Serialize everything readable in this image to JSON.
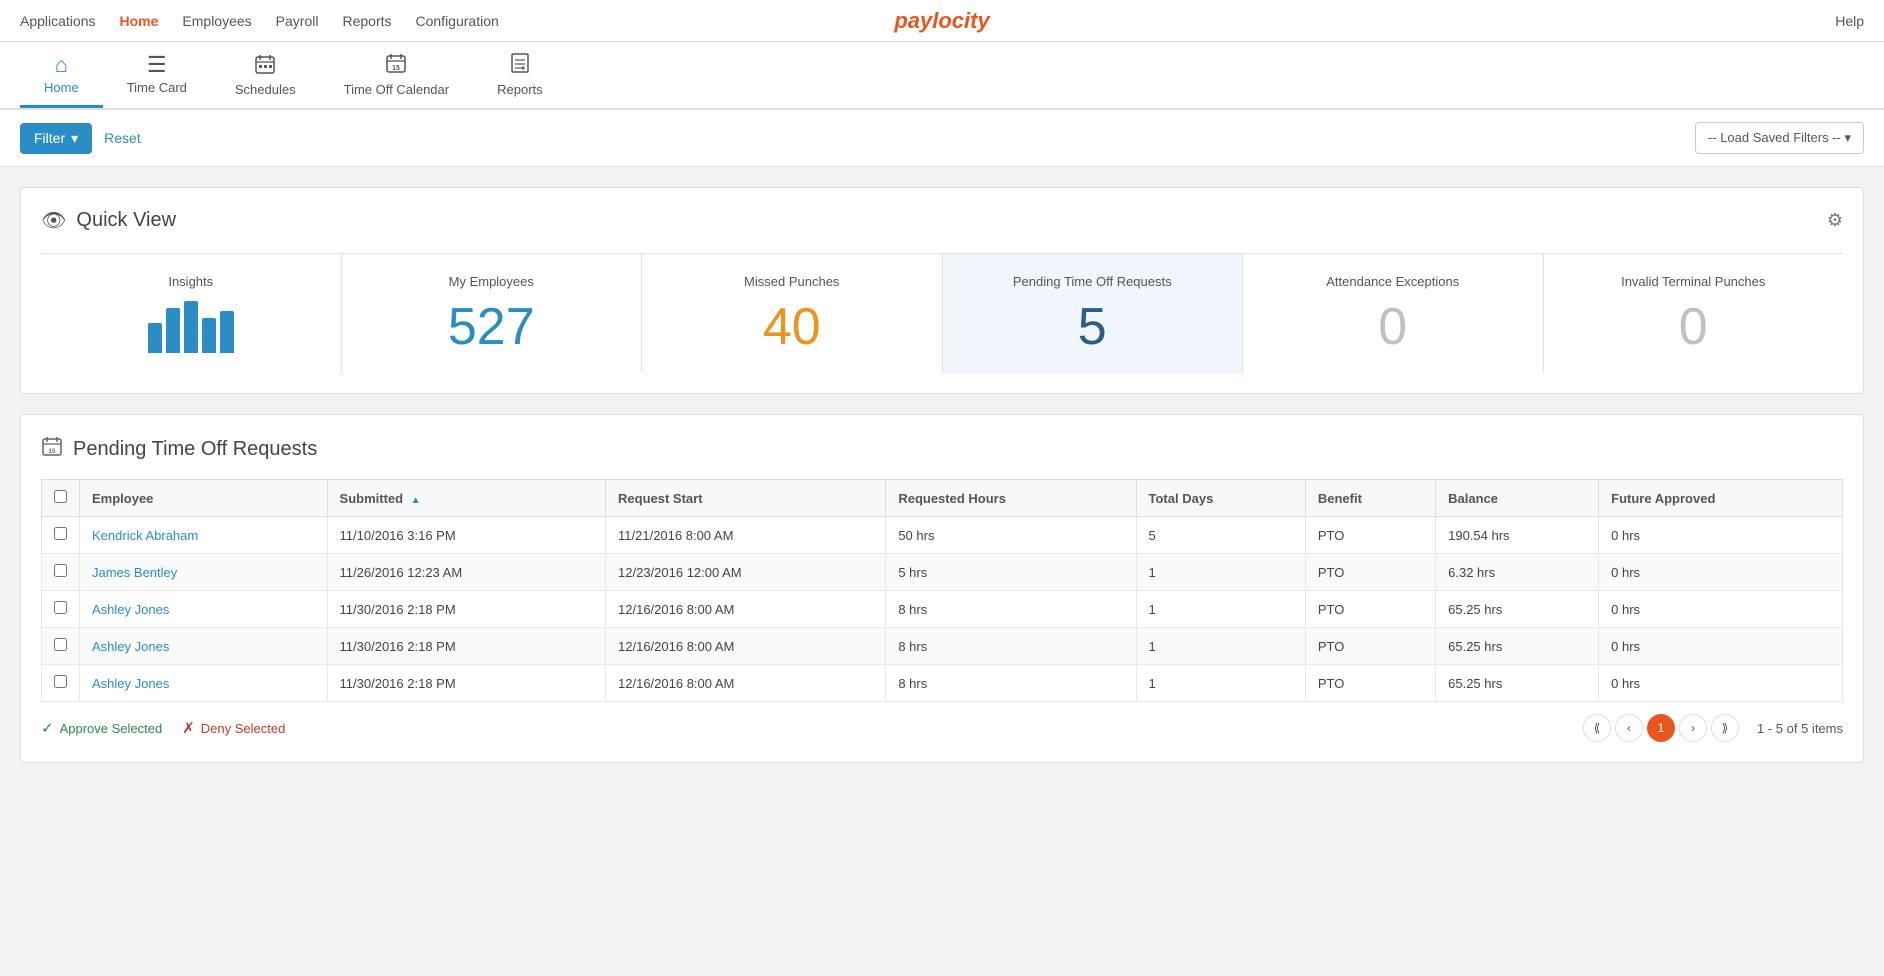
{
  "topbar": {
    "nav_items": [
      {
        "label": "Applications",
        "active": false
      },
      {
        "label": "Home",
        "active": true
      },
      {
        "label": "Employees",
        "active": false
      },
      {
        "label": "Payroll",
        "active": false
      },
      {
        "label": "Reports",
        "active": false
      },
      {
        "label": "Configuration",
        "active": false
      }
    ],
    "help_label": "Help",
    "logo": "paylocity"
  },
  "icon_nav": {
    "items": [
      {
        "label": "Home",
        "icon": "🏠",
        "active": true
      },
      {
        "label": "Time Card",
        "icon": "📋",
        "active": false
      },
      {
        "label": "Schedules",
        "icon": "📅",
        "active": false
      },
      {
        "label": "Time Off Calendar",
        "icon": "📅",
        "badge": "15",
        "active": false
      },
      {
        "label": "Reports",
        "icon": "📊",
        "active": false
      }
    ]
  },
  "filter_bar": {
    "filter_label": "Filter",
    "reset_label": "Reset",
    "load_filters_label": "-- Load Saved Filters -- ▾"
  },
  "quick_view": {
    "title": "Quick View",
    "settings_icon": "⚙",
    "metrics": [
      {
        "label": "Insights",
        "type": "chart",
        "bars": [
          30,
          45,
          60,
          35,
          52
        ]
      },
      {
        "label": "My Employees",
        "value": "527",
        "color": "blue"
      },
      {
        "label": "Missed Punches",
        "value": "40",
        "color": "orange"
      },
      {
        "label": "Pending Time Off Requests",
        "value": "5",
        "color": "dark-blue"
      },
      {
        "label": "Attendance Exceptions",
        "value": "0",
        "color": "gray"
      },
      {
        "label": "Invalid Terminal Punches",
        "value": "0",
        "color": "gray"
      }
    ]
  },
  "pending_requests": {
    "title": "Pending Time Off Requests",
    "icon": "📅",
    "columns": [
      "",
      "Employee",
      "Submitted",
      "Request Start",
      "Requested Hours",
      "Total Days",
      "Benefit",
      "Balance",
      "Future Approved"
    ],
    "rows": [
      {
        "employee": "Kendrick Abraham",
        "submitted": "11/10/2016 3:16 PM",
        "request_start": "11/21/2016 8:00 AM",
        "requested_hours": "50 hrs",
        "total_days": "5",
        "benefit": "PTO",
        "balance": "190.54 hrs",
        "future_approved": "0 hrs"
      },
      {
        "employee": "James Bentley",
        "submitted": "11/26/2016 12:23 AM",
        "request_start": "12/23/2016 12:00 AM",
        "requested_hours": "5 hrs",
        "total_days": "1",
        "benefit": "PTO",
        "balance": "6.32 hrs",
        "future_approved": "0 hrs"
      },
      {
        "employee": "Ashley Jones",
        "submitted": "11/30/2016 2:18 PM",
        "request_start": "12/16/2016 8:00 AM",
        "requested_hours": "8 hrs",
        "total_days": "1",
        "benefit": "PTO",
        "balance": "65.25 hrs",
        "future_approved": "0 hrs"
      },
      {
        "employee": "Ashley Jones",
        "submitted": "11/30/2016 2:18 PM",
        "request_start": "12/16/2016 8:00 AM",
        "requested_hours": "8 hrs",
        "total_days": "1",
        "benefit": "PTO",
        "balance": "65.25 hrs",
        "future_approved": "0 hrs"
      },
      {
        "employee": "Ashley Jones",
        "submitted": "11/30/2016 2:18 PM",
        "request_start": "12/16/2016 8:00 AM",
        "requested_hours": "8 hrs",
        "total_days": "1",
        "benefit": "PTO",
        "balance": "65.25 hrs",
        "future_approved": "0 hrs"
      }
    ],
    "approve_label": "Approve Selected",
    "deny_label": "Deny Selected",
    "pagination": {
      "current_page": 1,
      "total_pages": 1,
      "items_label": "1 - 5 of 5 items"
    }
  }
}
